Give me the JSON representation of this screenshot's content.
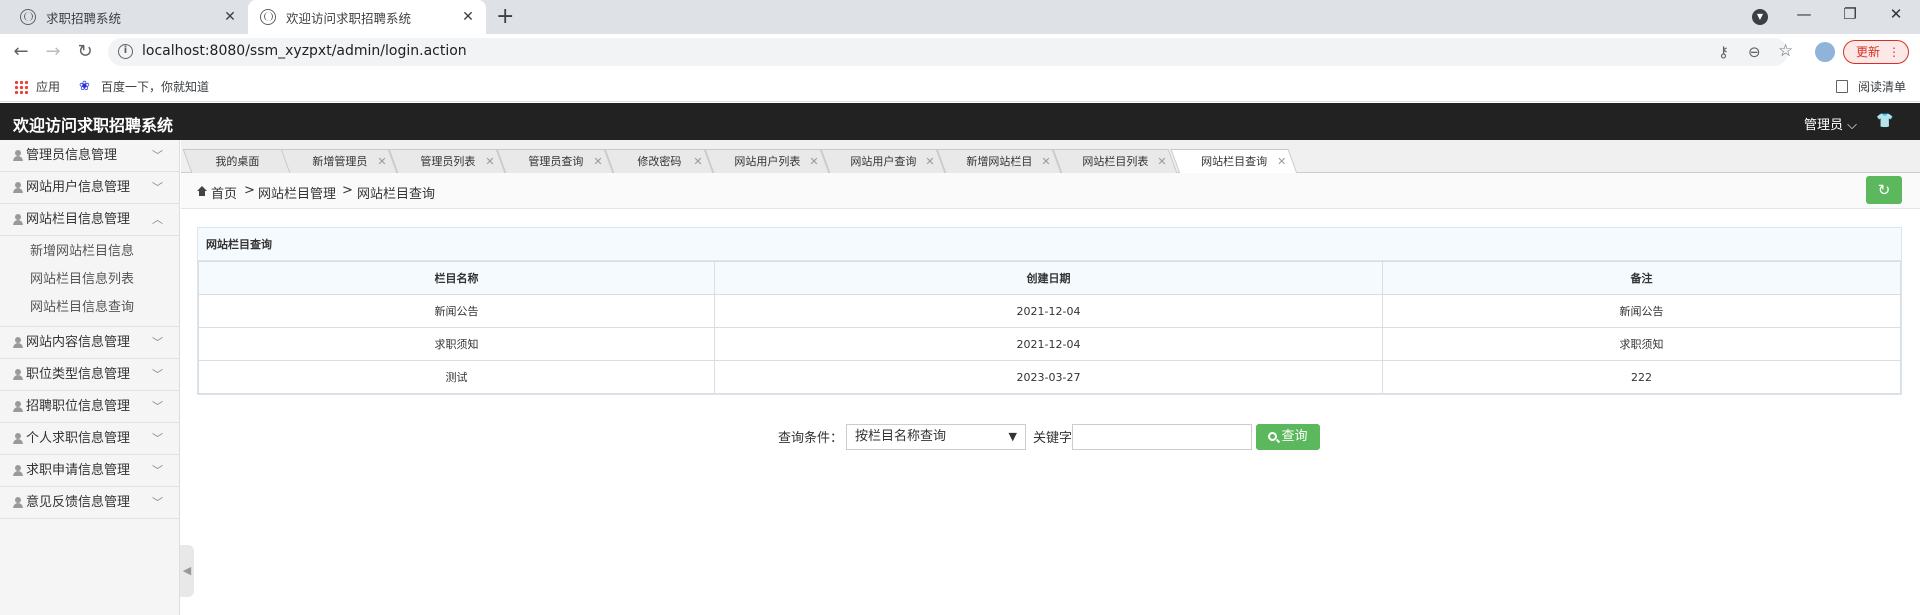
{
  "browser": {
    "tabs": [
      {
        "title": "求职招聘系统",
        "active": false
      },
      {
        "title": "欢迎访问求职招聘系统",
        "active": true
      }
    ],
    "url": "localhost:8080/ssm_xyzpxt/admin/login.action",
    "update_label": "更新",
    "bookmarks": {
      "apps": "应用",
      "baidu": "百度一下，你就知道",
      "reading_list": "阅读清单"
    }
  },
  "header": {
    "title": "欢迎访问求职招聘系统",
    "user_menu": "管理员"
  },
  "sidebar": {
    "items": [
      {
        "label": "管理员信息管理",
        "expanded": false
      },
      {
        "label": "网站用户信息管理",
        "expanded": false
      },
      {
        "label": "网站栏目信息管理",
        "expanded": true,
        "children": [
          "新增网站栏目信息",
          "网站栏目信息列表",
          "网站栏目信息查询"
        ]
      },
      {
        "label": "网站内容信息管理",
        "expanded": false
      },
      {
        "label": "职位类型信息管理",
        "expanded": false
      },
      {
        "label": "招聘职位信息管理",
        "expanded": false
      },
      {
        "label": "个人求职信息管理",
        "expanded": false
      },
      {
        "label": "求职申请信息管理",
        "expanded": false
      },
      {
        "label": "意见反馈信息管理",
        "expanded": false
      }
    ]
  },
  "content_tabs": [
    {
      "label": "我的桌面",
      "closable": false
    },
    {
      "label": "新增管理员",
      "closable": true
    },
    {
      "label": "管理员列表",
      "closable": true
    },
    {
      "label": "管理员查询",
      "closable": true
    },
    {
      "label": "修改密码",
      "closable": true
    },
    {
      "label": "网站用户列表",
      "closable": true
    },
    {
      "label": "网站用户查询",
      "closable": true
    },
    {
      "label": "新增网站栏目",
      "closable": true
    },
    {
      "label": "网站栏目列表",
      "closable": true
    },
    {
      "label": "网站栏目查询",
      "closable": true,
      "active": true
    }
  ],
  "breadcrumb": {
    "home": "首页",
    "level1": "网站栏目管理",
    "level2": "网站栏目查询",
    "sep": ">"
  },
  "table": {
    "caption": "网站栏目查询",
    "columns": [
      "栏目名称",
      "创建日期",
      "备注"
    ],
    "rows": [
      [
        "新闻公告",
        "2021-12-04",
        "新闻公告"
      ],
      [
        "求职须知",
        "2021-12-04",
        "求职须知"
      ],
      [
        "测试",
        "2023-03-27",
        "222"
      ]
    ]
  },
  "search": {
    "condition_label": "查询条件：",
    "condition_value": "按栏目名称查询",
    "keyword_label": "关键字",
    "keyword_value": "",
    "button_label": "查询"
  },
  "colors": {
    "header_bg": "#222222",
    "success": "#5cb85c",
    "update_red": "#d93025"
  }
}
